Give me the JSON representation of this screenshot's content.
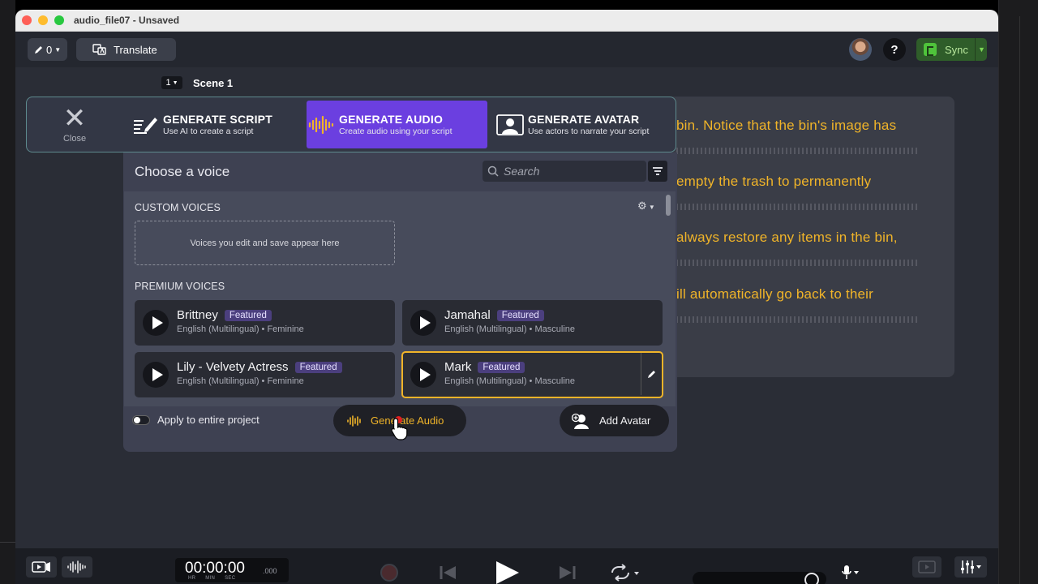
{
  "window": {
    "title": "audio_file07 - Unsaved"
  },
  "toolbar": {
    "edit_count": "0",
    "translate_label": "Translate",
    "help_label": "?",
    "sync_label": "Sync"
  },
  "scene": {
    "number": "1",
    "title": "Scene 1"
  },
  "script_lines": [
    "bin. Notice that the bin's image has",
    "empty the trash to permanently",
    "always restore any items in the bin,",
    "ill automatically go back to their"
  ],
  "tabs": {
    "close_label": "Close",
    "items": [
      {
        "title": "GENERATE SCRIPT",
        "subtitle": "Use AI to create a script"
      },
      {
        "title": "GENERATE AUDIO",
        "subtitle": "Create audio using your script"
      },
      {
        "title": "GENERATE AVATAR",
        "subtitle": "Use actors to narrate your script"
      }
    ]
  },
  "panel": {
    "title": "Choose a voice",
    "search_placeholder": "Search",
    "custom_voices_label": "CUSTOM VOICES",
    "custom_voices_empty": "Voices you edit and save appear here",
    "premium_voices_label": "PREMIUM VOICES",
    "voices": [
      {
        "name": "Brittney",
        "badge": "Featured",
        "description": "English (Multilingual) • Feminine"
      },
      {
        "name": "Jamahal",
        "badge": "Featured",
        "description": "English (Multilingual) • Masculine"
      },
      {
        "name": "Lily - Velvety Actress",
        "badge": "Featured",
        "description": "English (Multilingual) • Feminine"
      },
      {
        "name": "Mark",
        "badge": "Featured",
        "description": "English (Multilingual) • Masculine",
        "selected": true
      }
    ],
    "apply_label": "Apply to entire project",
    "generate_label": "Generate Audio",
    "add_avatar_label": "Add Avatar"
  },
  "playback": {
    "timecode": "00:00:00",
    "timecode_ms": ".000",
    "timecode_units": "HR MIN SEC"
  },
  "colors": {
    "accent_purple": "#6b3fe0",
    "script_yellow": "#f0b429",
    "sync_green": "#4fc43b"
  },
  "icons": [
    "pencil-icon",
    "translate-icon",
    "question-icon",
    "sync-logo-icon",
    "close-icon",
    "script-pen-icon",
    "audio-wave-icon",
    "avatar-portrait-icon",
    "search-icon",
    "filter-icon",
    "gear-icon",
    "play-icon",
    "edit-icon",
    "add-avatar-icon",
    "cursor-icon"
  ]
}
